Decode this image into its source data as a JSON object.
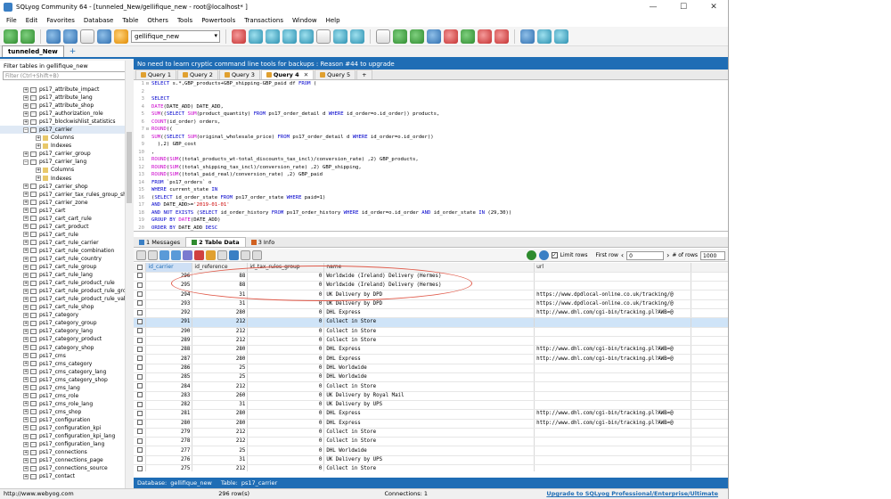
{
  "window": {
    "title": "SQLyog Community 64 - [tunneled_New/gellifique_new - root@localhost* ]",
    "min": "—",
    "max": "☐",
    "close": "✕"
  },
  "menu": [
    "File",
    "Edit",
    "Favorites",
    "Database",
    "Table",
    "Others",
    "Tools",
    "Powertools",
    "Transactions",
    "Window",
    "Help"
  ],
  "toolbar": {
    "database": "gellifique_new"
  },
  "connection_tab": "tunneled_New",
  "connection_add": "+",
  "sidebar": {
    "filter_label": "Filter tables in gellifique_new",
    "filter_placeholder": "Filter (Ctrl+Shift+B)",
    "items": [
      {
        "label": "ps17_attribute_impact",
        "kind": "table",
        "depth": 0
      },
      {
        "label": "ps17_attribute_lang",
        "kind": "table",
        "depth": 0
      },
      {
        "label": "ps17_attribute_shop",
        "kind": "table",
        "depth": 0
      },
      {
        "label": "ps17_authorization_role",
        "kind": "table",
        "depth": 0
      },
      {
        "label": "ps17_blockwishlist_statistics",
        "kind": "table",
        "depth": 0
      },
      {
        "label": "ps17_carrier",
        "kind": "table",
        "depth": 0,
        "open": true,
        "sel": true
      },
      {
        "label": "Columns",
        "kind": "folder",
        "depth": 1
      },
      {
        "label": "Indexes",
        "kind": "folder",
        "depth": 1
      },
      {
        "label": "ps17_carrier_group",
        "kind": "table",
        "depth": 0
      },
      {
        "label": "ps17_carrier_lang",
        "kind": "table",
        "depth": 0,
        "open": true
      },
      {
        "label": "Columns",
        "kind": "folder",
        "depth": 1
      },
      {
        "label": "Indexes",
        "kind": "folder",
        "depth": 1
      },
      {
        "label": "ps17_carrier_shop",
        "kind": "table",
        "depth": 0
      },
      {
        "label": "ps17_carrier_tax_rules_group_shop",
        "kind": "table",
        "depth": 0
      },
      {
        "label": "ps17_carrier_zone",
        "kind": "table",
        "depth": 0
      },
      {
        "label": "ps17_cart",
        "kind": "table",
        "depth": 0
      },
      {
        "label": "ps17_cart_cart_rule",
        "kind": "table",
        "depth": 0
      },
      {
        "label": "ps17_cart_product",
        "kind": "table",
        "depth": 0
      },
      {
        "label": "ps17_cart_rule",
        "kind": "table",
        "depth": 0
      },
      {
        "label": "ps17_cart_rule_carrier",
        "kind": "table",
        "depth": 0
      },
      {
        "label": "ps17_cart_rule_combination",
        "kind": "table",
        "depth": 0
      },
      {
        "label": "ps17_cart_rule_country",
        "kind": "table",
        "depth": 0
      },
      {
        "label": "ps17_cart_rule_group",
        "kind": "table",
        "depth": 0
      },
      {
        "label": "ps17_cart_rule_lang",
        "kind": "table",
        "depth": 0
      },
      {
        "label": "ps17_cart_rule_product_rule",
        "kind": "table",
        "depth": 0
      },
      {
        "label": "ps17_cart_rule_product_rule_group",
        "kind": "table",
        "depth": 0
      },
      {
        "label": "ps17_cart_rule_product_rule_value",
        "kind": "table",
        "depth": 0
      },
      {
        "label": "ps17_cart_rule_shop",
        "kind": "table",
        "depth": 0
      },
      {
        "label": "ps17_category",
        "kind": "table",
        "depth": 0
      },
      {
        "label": "ps17_category_group",
        "kind": "table",
        "depth": 0
      },
      {
        "label": "ps17_category_lang",
        "kind": "table",
        "depth": 0
      },
      {
        "label": "ps17_category_product",
        "kind": "table",
        "depth": 0
      },
      {
        "label": "ps17_category_shop",
        "kind": "table",
        "depth": 0
      },
      {
        "label": "ps17_cms",
        "kind": "table",
        "depth": 0
      },
      {
        "label": "ps17_cms_category",
        "kind": "table",
        "depth": 0
      },
      {
        "label": "ps17_cms_category_lang",
        "kind": "table",
        "depth": 0
      },
      {
        "label": "ps17_cms_category_shop",
        "kind": "table",
        "depth": 0
      },
      {
        "label": "ps17_cms_lang",
        "kind": "table",
        "depth": 0
      },
      {
        "label": "ps17_cms_role",
        "kind": "table",
        "depth": 0
      },
      {
        "label": "ps17_cms_role_lang",
        "kind": "table",
        "depth": 0
      },
      {
        "label": "ps17_cms_shop",
        "kind": "table",
        "depth": 0
      },
      {
        "label": "ps17_configuration",
        "kind": "table",
        "depth": 0
      },
      {
        "label": "ps17_configuration_kpi",
        "kind": "table",
        "depth": 0
      },
      {
        "label": "ps17_configuration_kpi_lang",
        "kind": "table",
        "depth": 0
      },
      {
        "label": "ps17_configuration_lang",
        "kind": "table",
        "depth": 0
      },
      {
        "label": "ps17_connections",
        "kind": "table",
        "depth": 0
      },
      {
        "label": "ps17_connections_page",
        "kind": "table",
        "depth": 0
      },
      {
        "label": "ps17_connections_source",
        "kind": "table",
        "depth": 0
      },
      {
        "label": "ps17_contact",
        "kind": "table",
        "depth": 0
      }
    ]
  },
  "banner": "No need to learn cryptic command line tools for backups : Reason #44 to upgrade",
  "query_tabs": [
    {
      "label": "Query 1",
      "active": false
    },
    {
      "label": "Query 2",
      "active": false
    },
    {
      "label": "Query 3",
      "active": false
    },
    {
      "label": "Query 4",
      "active": true
    },
    {
      "label": "Query 5",
      "active": false
    }
  ],
  "query_tab_add": "+",
  "editor_lines": [
    "SELECT s.*,GBP_products+GBP_shipping-GBP_paid df FROM (",
    "",
    "SELECT",
    "DATE(DATE_ADD) DATE_ADD,",
    "SUM((SELECT SUM(product_quantity) FROM ps17_order_detail d WHERE id_order=o.id_order)) products,",
    "COUNT(id_order) orders,",
    "ROUND((",
    "SUM((SELECT SUM(original_wholesale_price) FROM ps17_order_detail d WHERE id_order=o.id_order))",
    "  ),2) GBP_cost",
    ",",
    "ROUND(SUM((total_products_wt-total_discounts_tax_incl)/conversion_rate) ,2) GBP_products,",
    "ROUND(SUM((total_shipping_tax_incl)/conversion_rate) ,2) GBP_shipping,",
    "ROUND(SUM((total_paid_real)/conversion_rate) ,2) GBP_paid",
    "FROM `ps17_orders` o",
    "WHERE current_state IN",
    "(SELECT id_order_state FROM ps17_order_state WHERE paid=1)",
    "AND DATE_ADD>='2019-01-01'",
    "AND NOT EXISTS (SELECT id_order_history FROM ps17_order_history WHERE id_order=o.id_order AND id_order_state IN (29,30))",
    "GROUP BY DATE(DATE_ADD)",
    "ORDER BY DATE_ADD DESC"
  ],
  "result_tabs": [
    {
      "label": "1 Messages",
      "active": false,
      "color": "#3a7fc4"
    },
    {
      "label": "2 Table Data",
      "active": true,
      "color": "#2e8b2e"
    },
    {
      "label": "3 Info",
      "active": false,
      "color": "#d06020"
    }
  ],
  "grid_toolbar": {
    "limit_rows_label": "Limit rows",
    "limit_checked": "✓",
    "first_row_label": "First row",
    "first_row_value": "0",
    "num_rows_label": "# of rows",
    "num_rows_value": "1000"
  },
  "grid": {
    "columns": [
      "id_carrier",
      "id_reference",
      "id_tax_rules_group",
      "name",
      "url"
    ],
    "rows": [
      [
        "296",
        "88",
        "0",
        "Worldwide (Ireland) Delivery (Hermes)",
        ""
      ],
      [
        "295",
        "88",
        "0",
        "Worldwide (Ireland) Delivery (Hermes)",
        ""
      ],
      [
        "294",
        "31",
        "0",
        "UK Delivery by DPD",
        "https://www.dpdlocal-online.co.uk/tracking/@"
      ],
      [
        "293",
        "31",
        "0",
        "UK Delivery by DPD",
        "https://www.dpdlocal-online.co.uk/tracking/@"
      ],
      [
        "292",
        "280",
        "0",
        "DHL Express",
        "http://www.dhl.com/cgi-bin/tracking.pl?AWB=@"
      ],
      [
        "291",
        "212",
        "0",
        "Collect in Store",
        ""
      ],
      [
        "290",
        "212",
        "0",
        "Collect in Store",
        ""
      ],
      [
        "289",
        "212",
        "0",
        "Collect in Store",
        ""
      ],
      [
        "288",
        "280",
        "0",
        "DHL Express",
        "http://www.dhl.com/cgi-bin/tracking.pl?AWB=@"
      ],
      [
        "287",
        "280",
        "0",
        "DHL Express",
        "http://www.dhl.com/cgi-bin/tracking.pl?AWB=@"
      ],
      [
        "286",
        "25",
        "0",
        "DHL Worldwide",
        ""
      ],
      [
        "285",
        "25",
        "0",
        "DHL Worldwide",
        ""
      ],
      [
        "284",
        "212",
        "0",
        "Collect in Store",
        ""
      ],
      [
        "283",
        "260",
        "0",
        "UK Delivery by Royal Mail",
        ""
      ],
      [
        "282",
        "31",
        "0",
        "UK Delivery by UPS",
        ""
      ],
      [
        "281",
        "280",
        "0",
        "DHL Express",
        "http://www.dhl.com/cgi-bin/tracking.pl?AWB=@"
      ],
      [
        "280",
        "280",
        "0",
        "DHL Express",
        "http://www.dhl.com/cgi-bin/tracking.pl?AWB=@"
      ],
      [
        "279",
        "212",
        "0",
        "Collect in Store",
        ""
      ],
      [
        "278",
        "212",
        "0",
        "Collect in Store",
        ""
      ],
      [
        "277",
        "25",
        "0",
        "DHL Worldwide",
        ""
      ],
      [
        "276",
        "31",
        "0",
        "UK Delivery by UPS",
        ""
      ],
      [
        "275",
        "212",
        "0",
        "Collect in Store",
        ""
      ]
    ],
    "selected_row": 5
  },
  "status_inner": {
    "db_label": "Database:",
    "db_value": "gellifique_new",
    "table_label": "Table:",
    "table_value": "ps17_carrier"
  },
  "statusbar": {
    "url": "http://www.webyog.com",
    "rows": "296 row(s)",
    "connections": "Connections: 1",
    "upgrade": "Upgrade to SQLyog Professional/Enterprise/Ultimate"
  },
  "colors": {
    "accent": "#1f6db5",
    "annotation": "#e05a4a",
    "selected_row": "#cfe4f8"
  }
}
